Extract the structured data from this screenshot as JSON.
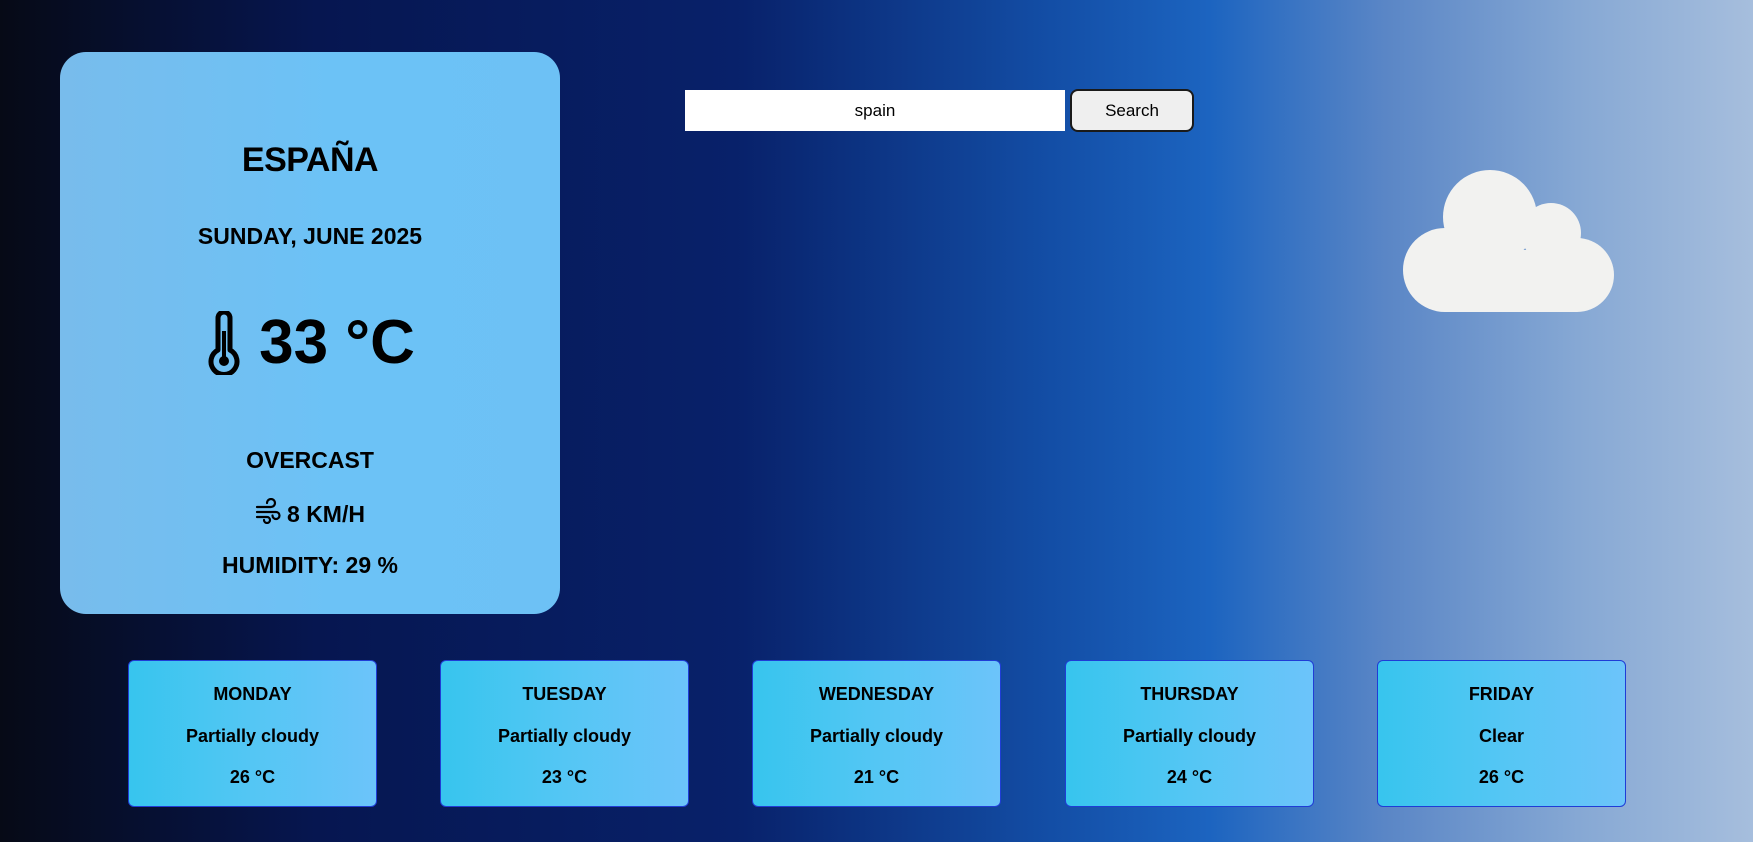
{
  "current": {
    "city": "ESPAÑA",
    "date": "SUNDAY, JUNE 2025",
    "temperature": "33 °C",
    "temperature_icon": "thermometer-icon",
    "condition": "OVERCAST",
    "wind": "8 KM/H",
    "wind_icon": "wind-icon",
    "humidity_label": "HUMIDITY:",
    "humidity_value": "29",
    "humidity_unit": "%"
  },
  "search": {
    "value": "spain",
    "button_label": "Search"
  },
  "weather_icon": "cloud-icon",
  "forecast": [
    {
      "day": "MONDAY",
      "condition": "Partially cloudy",
      "temp": "26 °C"
    },
    {
      "day": "TUESDAY",
      "condition": "Partially cloudy",
      "temp": "23 °C"
    },
    {
      "day": "WEDNESDAY",
      "condition": "Partially cloudy",
      "temp": "21 °C"
    },
    {
      "day": "THURSDAY",
      "condition": "Partially cloudy",
      "temp": "24 °C"
    },
    {
      "day": "FRIDAY",
      "condition": "Clear",
      "temp": "26 °C"
    }
  ],
  "colors": {
    "card_bg": "#6cc2f6",
    "forecast_border": "#1f3dd6",
    "cloud": "#f2f2f0"
  }
}
